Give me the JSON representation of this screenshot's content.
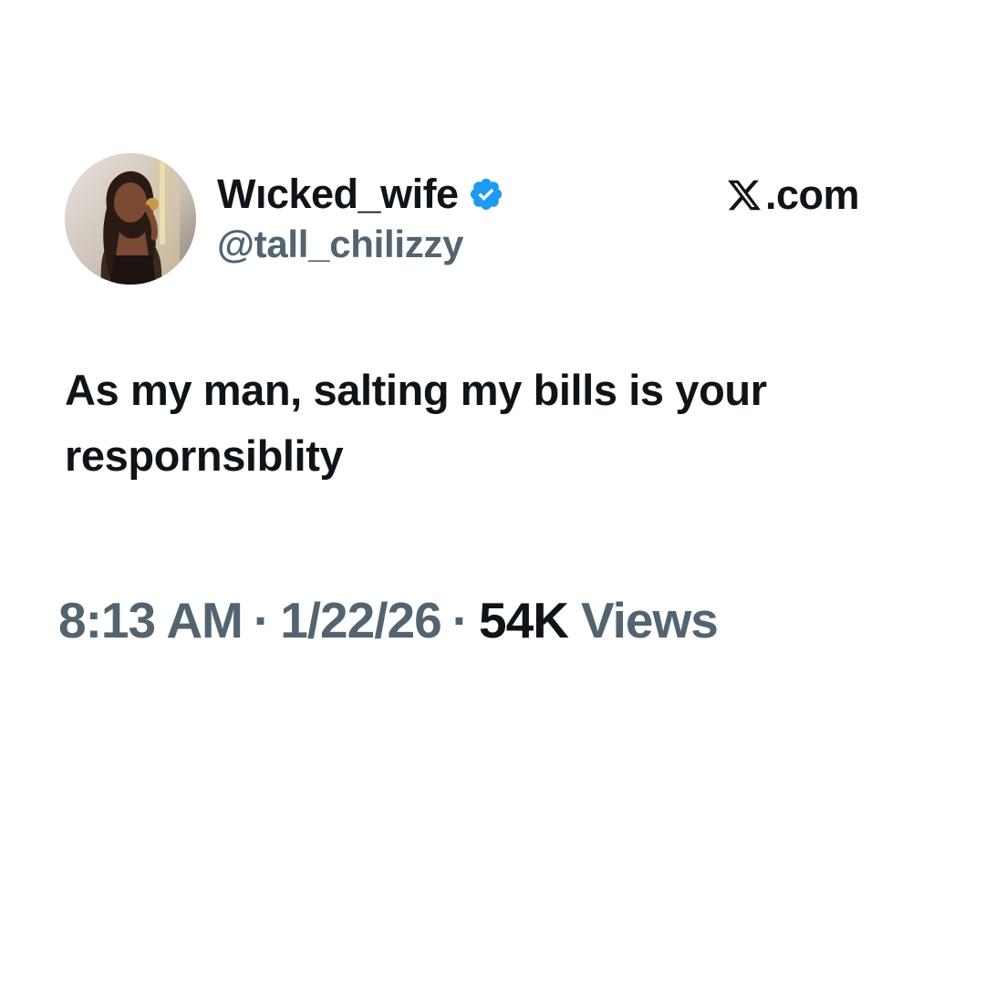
{
  "author": {
    "display_name": "Wıcked_wife",
    "handle": "@tall_chilizzy",
    "verified_icon": "verified-badge-icon",
    "avatar": "profile-photo"
  },
  "source": {
    "logo_icon": "x-logo-icon",
    "label": ".com"
  },
  "tweet": {
    "text": "As my man, salting my bills is your respornsiblity"
  },
  "meta": {
    "time": "8:13 AM",
    "separator": "·",
    "date": "1/22/26",
    "views_count": "54K",
    "views_label": "Views"
  },
  "colors": {
    "text_primary": "#0f1419",
    "text_secondary": "#536471",
    "verified_blue": "#1d9bf0",
    "background": "#ffffff"
  }
}
